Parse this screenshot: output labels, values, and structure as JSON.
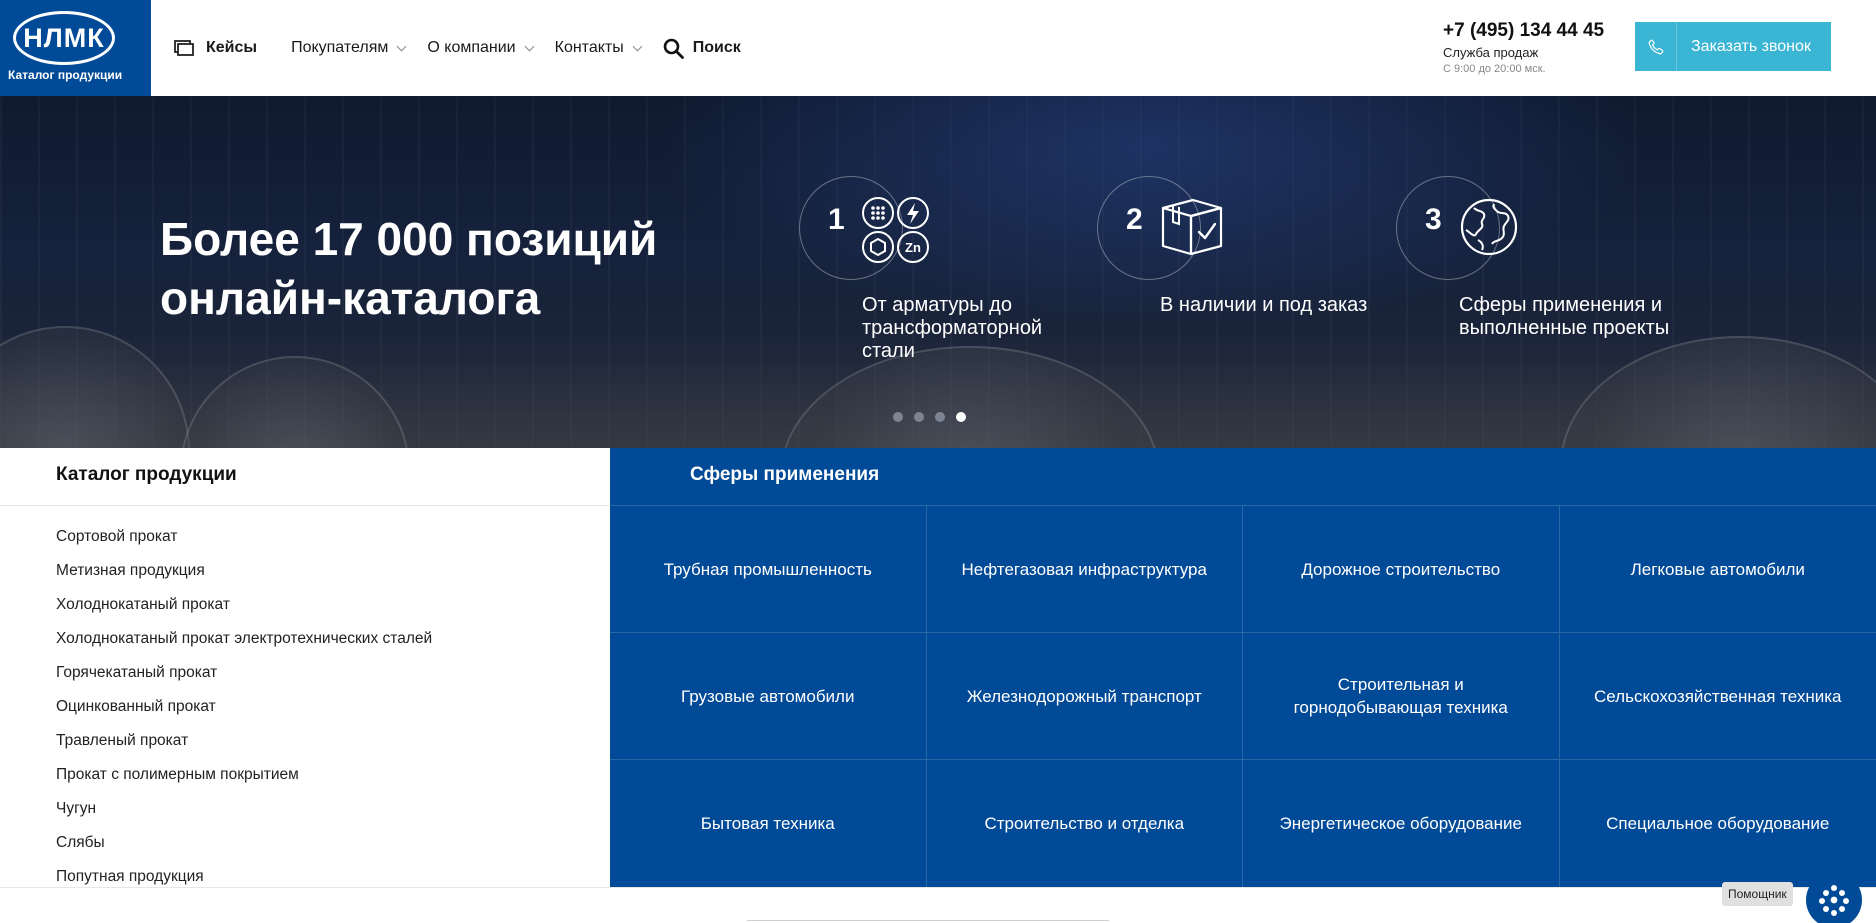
{
  "header": {
    "logo_text": "НЛМК",
    "logo_caption": "Каталог продукции",
    "nav": [
      {
        "label": "Кейсы"
      },
      {
        "label": "Покупателям"
      },
      {
        "label": "О компании"
      },
      {
        "label": "Контакты"
      },
      {
        "label": "Поиск"
      }
    ],
    "phone": "+7 (495) 134 44 45",
    "phone_label": "Служба продаж",
    "phone_hours": "С 9:00 до 20:00 мск.",
    "callback_label": "Заказать звонок",
    "accent_color": "#004a97",
    "callback_color": "#3ab5d4"
  },
  "hero": {
    "title_line1": "Более 17 000 позиций",
    "title_line2": "онлайн-каталога",
    "features": [
      {
        "number": "1",
        "text": "От арматуры до трансформаторной стали",
        "icon": "steel-types-icon"
      },
      {
        "number": "2",
        "text": "В наличии и под заказ",
        "icon": "box-check-icon"
      },
      {
        "number": "3",
        "text": "Сферы применения и выполненные проекты",
        "icon": "globe-icon"
      }
    ],
    "slides_total": 4,
    "active_slide": 4
  },
  "catalog": {
    "title": "Каталог продукции",
    "items": [
      "Сортовой прокат",
      "Метизная продукция",
      "Холоднокатаный прокат",
      "Холоднокатаный прокат электротехнических сталей",
      "Горячекатаный прокат",
      "Оцинкованный прокат",
      "Травленый прокат",
      "Прокат с полимерным покрытием",
      "Чугун",
      "Слябы",
      "Попутная продукция"
    ]
  },
  "spheres": {
    "title": "Сферы применения",
    "items": [
      "Трубная промышленность",
      "Нефтегазовая инфраструктура",
      "Дорожное строительство",
      "Легковые автомобили",
      "Грузовые автомобили",
      "Железнодорожный транспорт",
      "Строительная и горнодобывающая техника",
      "Сельскохозяйственная техника",
      "Бытовая техника",
      "Строительство и отделка",
      "Энергетическое оборудование",
      "Специальное оборудование"
    ]
  },
  "assistant": {
    "label": "Помощник"
  }
}
